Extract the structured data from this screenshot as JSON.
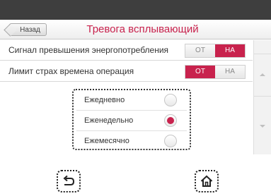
{
  "header": {
    "back_label": "Назад",
    "title": "Тревога всплывающий"
  },
  "settings": [
    {
      "label": "Сигнал превышения энергопотребления",
      "off_label": "ОТ",
      "on_label": "НА",
      "active": "on"
    },
    {
      "label": "Лимит страх времена операция",
      "off_label": "ОТ",
      "on_label": "НА",
      "active": "off"
    }
  ],
  "frequency": {
    "options": [
      "Ежедневно",
      "Еженедельно",
      "Ежемесячно"
    ],
    "selected": "Еженедельно"
  },
  "colors": {
    "accent": "#c8224d",
    "topbar": "#3e3e3e"
  },
  "icons": {
    "back": "back-arrow-icon",
    "home": "home-icon",
    "scroll_up": "scroll-up-icon",
    "scroll_down": "scroll-down-icon"
  }
}
